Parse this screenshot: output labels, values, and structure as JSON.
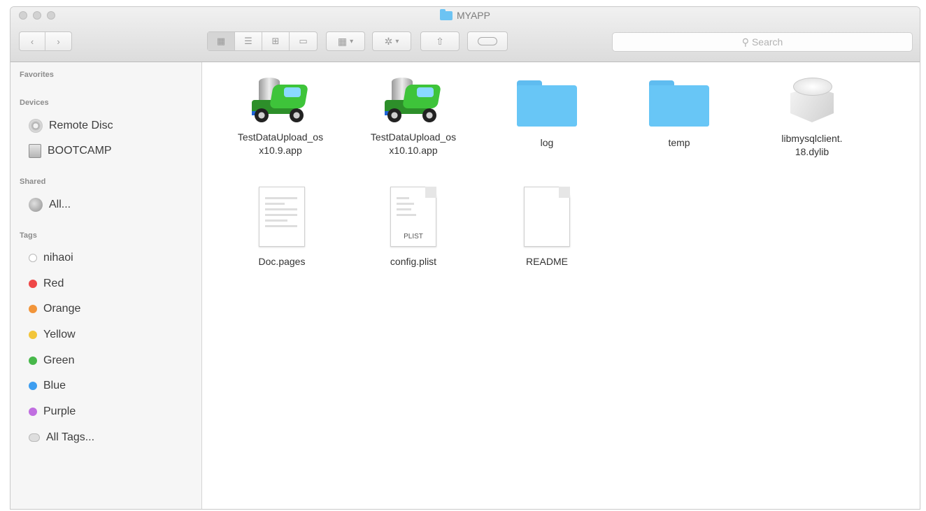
{
  "window": {
    "title": "MYAPP"
  },
  "toolbar": {
    "back": "‹",
    "forward": "›",
    "view_modes": [
      "▦",
      "☰",
      "⊞",
      "▭"
    ],
    "search_placeholder": "Search"
  },
  "sidebar": {
    "favorites_header": "Favorites",
    "devices_header": "Devices",
    "devices": [
      {
        "label": "Remote Disc",
        "icon": "disc-icon"
      },
      {
        "label": "BOOTCAMP",
        "icon": "drive-icon"
      }
    ],
    "shared_header": "Shared",
    "shared": [
      {
        "label": "All...",
        "icon": "network-icon"
      }
    ],
    "tags_header": "Tags",
    "tags": [
      {
        "label": "nihaoi",
        "color": "#ffffff"
      },
      {
        "label": "Red",
        "color": "#ef4747"
      },
      {
        "label": "Orange",
        "color": "#f2953a"
      },
      {
        "label": "Yellow",
        "color": "#f2c53a"
      },
      {
        "label": "Green",
        "color": "#47b84a"
      },
      {
        "label": "Blue",
        "color": "#3e9ef0"
      },
      {
        "label": "Purple",
        "color": "#c06ee0"
      },
      {
        "label": "All Tags...",
        "color": "#dedede"
      }
    ]
  },
  "files": [
    {
      "name": "TestDataUpload_os\nx10.9.app",
      "kind": "app"
    },
    {
      "name": "TestDataUpload_os\nx10.10.app",
      "kind": "app"
    },
    {
      "name": "log",
      "kind": "folder"
    },
    {
      "name": "temp",
      "kind": "folder"
    },
    {
      "name": "libmysqlclient.\n18.dylib",
      "kind": "library"
    },
    {
      "name": "Doc.pages",
      "kind": "pages"
    },
    {
      "name": "config.plist",
      "kind": "plist",
      "badge": "PLIST"
    },
    {
      "name": "README",
      "kind": "text"
    }
  ]
}
